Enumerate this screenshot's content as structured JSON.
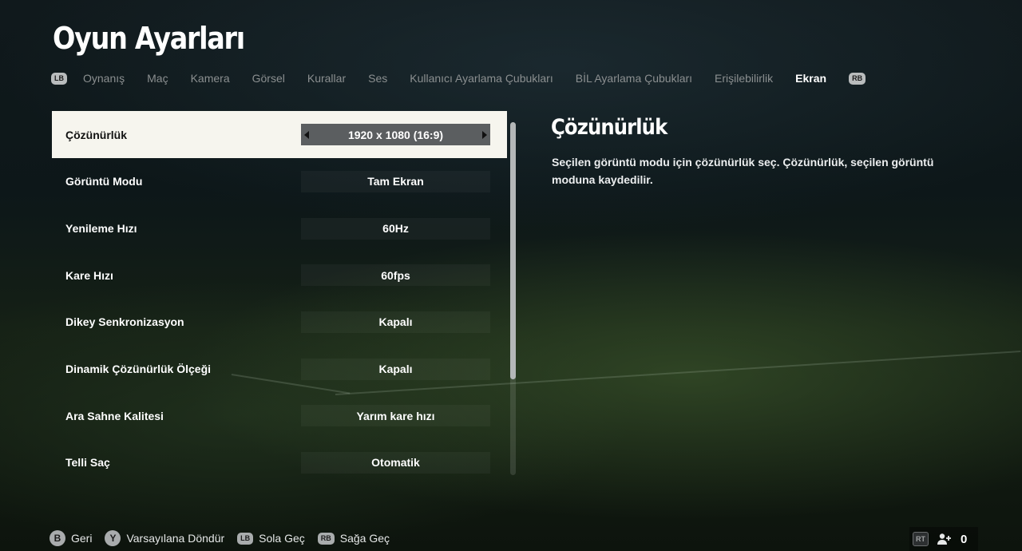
{
  "page": {
    "title": "Oyun Ayarları"
  },
  "tabs": {
    "lb": "LB",
    "rb": "RB",
    "items": [
      {
        "label": "Oynanış"
      },
      {
        "label": "Maç"
      },
      {
        "label": "Kamera"
      },
      {
        "label": "Görsel"
      },
      {
        "label": "Kurallar"
      },
      {
        "label": "Ses"
      },
      {
        "label": "Kullanıcı Ayarlama Çubukları"
      },
      {
        "label": "BİL Ayarlama Çubukları"
      },
      {
        "label": "Erişilebilirlik"
      },
      {
        "label": "Ekran"
      }
    ]
  },
  "settings": {
    "rows": [
      {
        "label": "Çözünürlük",
        "value": "1920 x 1080 (16:9)"
      },
      {
        "label": "Görüntü Modu",
        "value": "Tam Ekran"
      },
      {
        "label": "Yenileme Hızı",
        "value": "60Hz"
      },
      {
        "label": "Kare Hızı",
        "value": "60fps"
      },
      {
        "label": "Dikey Senkronizasyon",
        "value": "Kapalı"
      },
      {
        "label": "Dinamik Çözünürlük Ölçeği",
        "value": "Kapalı"
      },
      {
        "label": "Ara Sahne Kalitesi",
        "value": "Yarım kare hızı"
      },
      {
        "label": "Telli Saç",
        "value": "Otomatik"
      }
    ]
  },
  "detail": {
    "title": "Çözünürlük",
    "description": "Seçilen görüntü modu için çözünürlük seç. Çözünürlük, seçilen görüntü moduna kaydedilir."
  },
  "footer": {
    "back": {
      "key": "B",
      "label": "Geri"
    },
    "reset": {
      "key": "Y",
      "label": "Varsayılana Döndür"
    },
    "prev": {
      "key": "LB",
      "label": "Sola Geç"
    },
    "next": {
      "key": "RB",
      "label": "Sağa Geç"
    },
    "rt": "RT",
    "friends_count": "0"
  }
}
